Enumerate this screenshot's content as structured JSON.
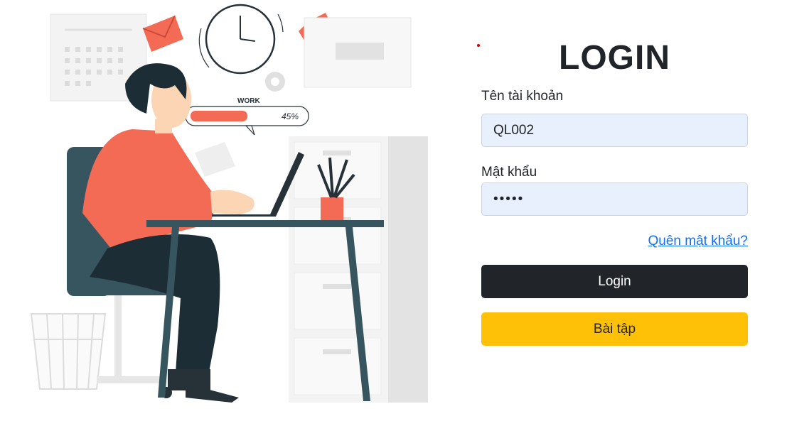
{
  "illustration": {
    "progress_title": "WORK",
    "progress_value_label": "45%",
    "progress_fraction": 0.45,
    "accent_color": "#f46b55",
    "dark_color": "#263238"
  },
  "login": {
    "title": "LOGIN",
    "username_label": "Tên tài khoản",
    "username_value": "QL002",
    "password_label": "Mật khẩu",
    "password_value": "•••••",
    "forgot_label": "Quên mật khẩu?",
    "login_button": "Login",
    "exercise_button": "Bài tập"
  },
  "colors": {
    "login_button_bg": "#212529",
    "exercise_button_bg": "#ffc107",
    "input_bg": "#e8f0fe",
    "link": "#0d6efd"
  }
}
